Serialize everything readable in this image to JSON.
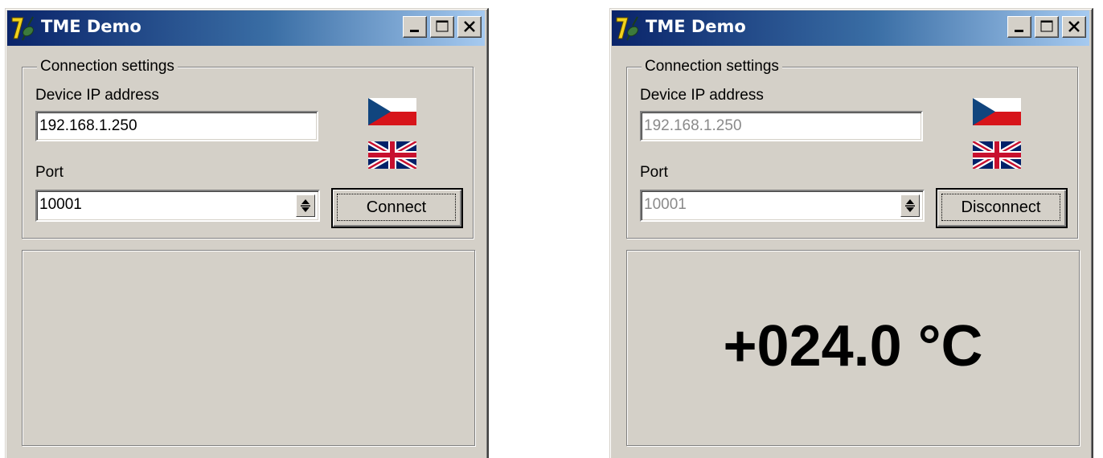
{
  "windows": [
    {
      "title": "TME Demo",
      "group_label": "Connection settings",
      "ip_label": "Device IP address",
      "ip_value": "192.168.1.250",
      "port_label": "Port",
      "port_value": "10001",
      "button_label": "Connect",
      "fields_enabled": true,
      "temperature": ""
    },
    {
      "title": "TME Demo",
      "group_label": "Connection settings",
      "ip_label": "Device IP address",
      "ip_value": "192.168.1.250",
      "port_label": "Port",
      "port_value": "10001",
      "button_label": "Disconnect",
      "fields_enabled": false,
      "temperature": "+024.0 °C"
    }
  ],
  "icons": {
    "app": "tme-app-icon",
    "minimize": "minimize-icon",
    "maximize": "maximize-icon",
    "close": "close-icon",
    "czech_flag": "czech-flag-icon",
    "uk_flag": "uk-flag-icon",
    "spin": "spin-arrows-icon"
  },
  "colors": {
    "titlebar_start": "#0a246a",
    "titlebar_end": "#a6caf0",
    "window_face": "#d4d0c8",
    "disabled_text": "#8a8a8a"
  }
}
